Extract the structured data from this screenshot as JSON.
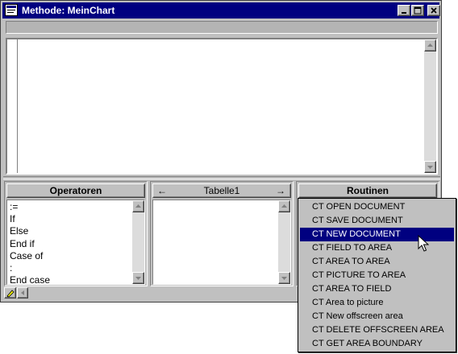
{
  "window": {
    "title": "Methode: MeinChart"
  },
  "panels": {
    "operators": {
      "title": "Operatoren",
      "items": [
        ":=",
        "If",
        "Else",
        "End if",
        "Case of",
        ":",
        "End case"
      ]
    },
    "tables": {
      "title": "Tabelle1",
      "prev_arrow": "←",
      "next_arrow": "→"
    },
    "routines": {
      "title": "Routinen"
    }
  },
  "routines_menu": {
    "selected_index": 2,
    "items": [
      "CT OPEN DOCUMENT",
      "CT SAVE DOCUMENT",
      "CT NEW DOCUMENT",
      "CT FIELD TO AREA",
      "CT AREA TO AREA",
      "CT PICTURE TO AREA",
      "CT AREA TO FIELD",
      "CT Area to picture",
      "CT New offscreen area",
      "CT DELETE OFFSCREEN AREA",
      "CT GET AREA BOUNDARY"
    ]
  },
  "colors": {
    "titlebar": "#000080",
    "window_face": "#c0c0c0",
    "selection": "#000080"
  },
  "icons": [
    "app-icon",
    "minimize-icon",
    "maximize-icon",
    "close-icon",
    "scroll-up-icon",
    "scroll-down-icon",
    "pencil-icon",
    "scroll-left-icon",
    "mouse-pointer-icon"
  ]
}
